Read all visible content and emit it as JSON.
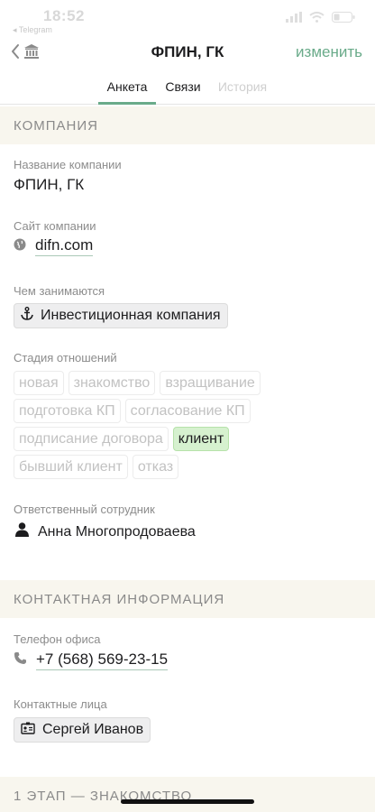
{
  "status": {
    "time": "18:52",
    "back_app": "◂ Telegram"
  },
  "nav": {
    "title": "ФПИН, ГК",
    "edit": "изменить"
  },
  "tabs": {
    "profile": "Анкета",
    "links": "Связи",
    "history": "История"
  },
  "company": {
    "header": "КОМПАНИЯ",
    "name_label": "Название компании",
    "name_value": "ФПИН, ГК",
    "site_label": "Сайт компании",
    "site_value": "difn.com",
    "activity_label": "Чем занимаются",
    "activity_value": "Инвестиционная компания",
    "stage_label": "Стадия отношений",
    "stages": [
      [
        "новая",
        "знакомство",
        "взращивание"
      ],
      [
        "подготовка КП",
        "согласование КП"
      ],
      [
        "подписание договора",
        "клиент"
      ],
      [
        "бывший клиент",
        "отказ"
      ]
    ],
    "active_stage": "клиент",
    "owner_label": "Ответственный сотрудник",
    "owner_value": "Анна Многопродоваева"
  },
  "contacts": {
    "header": "КОНТАКТНАЯ ИНФОРМАЦИЯ",
    "phone_label": "Телефон офиса",
    "phone_value": "+7 (568) 569-23-15",
    "persons_label": "Контактные лица",
    "person_value": "Сергей Иванов"
  },
  "next_section": {
    "header": "1 ЭТАП — ЗНАКОМСТВО"
  },
  "colors": {
    "accent": "#6aab8a",
    "section_bg": "#f8f6ee",
    "active_stage_bg": "#d6f1cf"
  }
}
